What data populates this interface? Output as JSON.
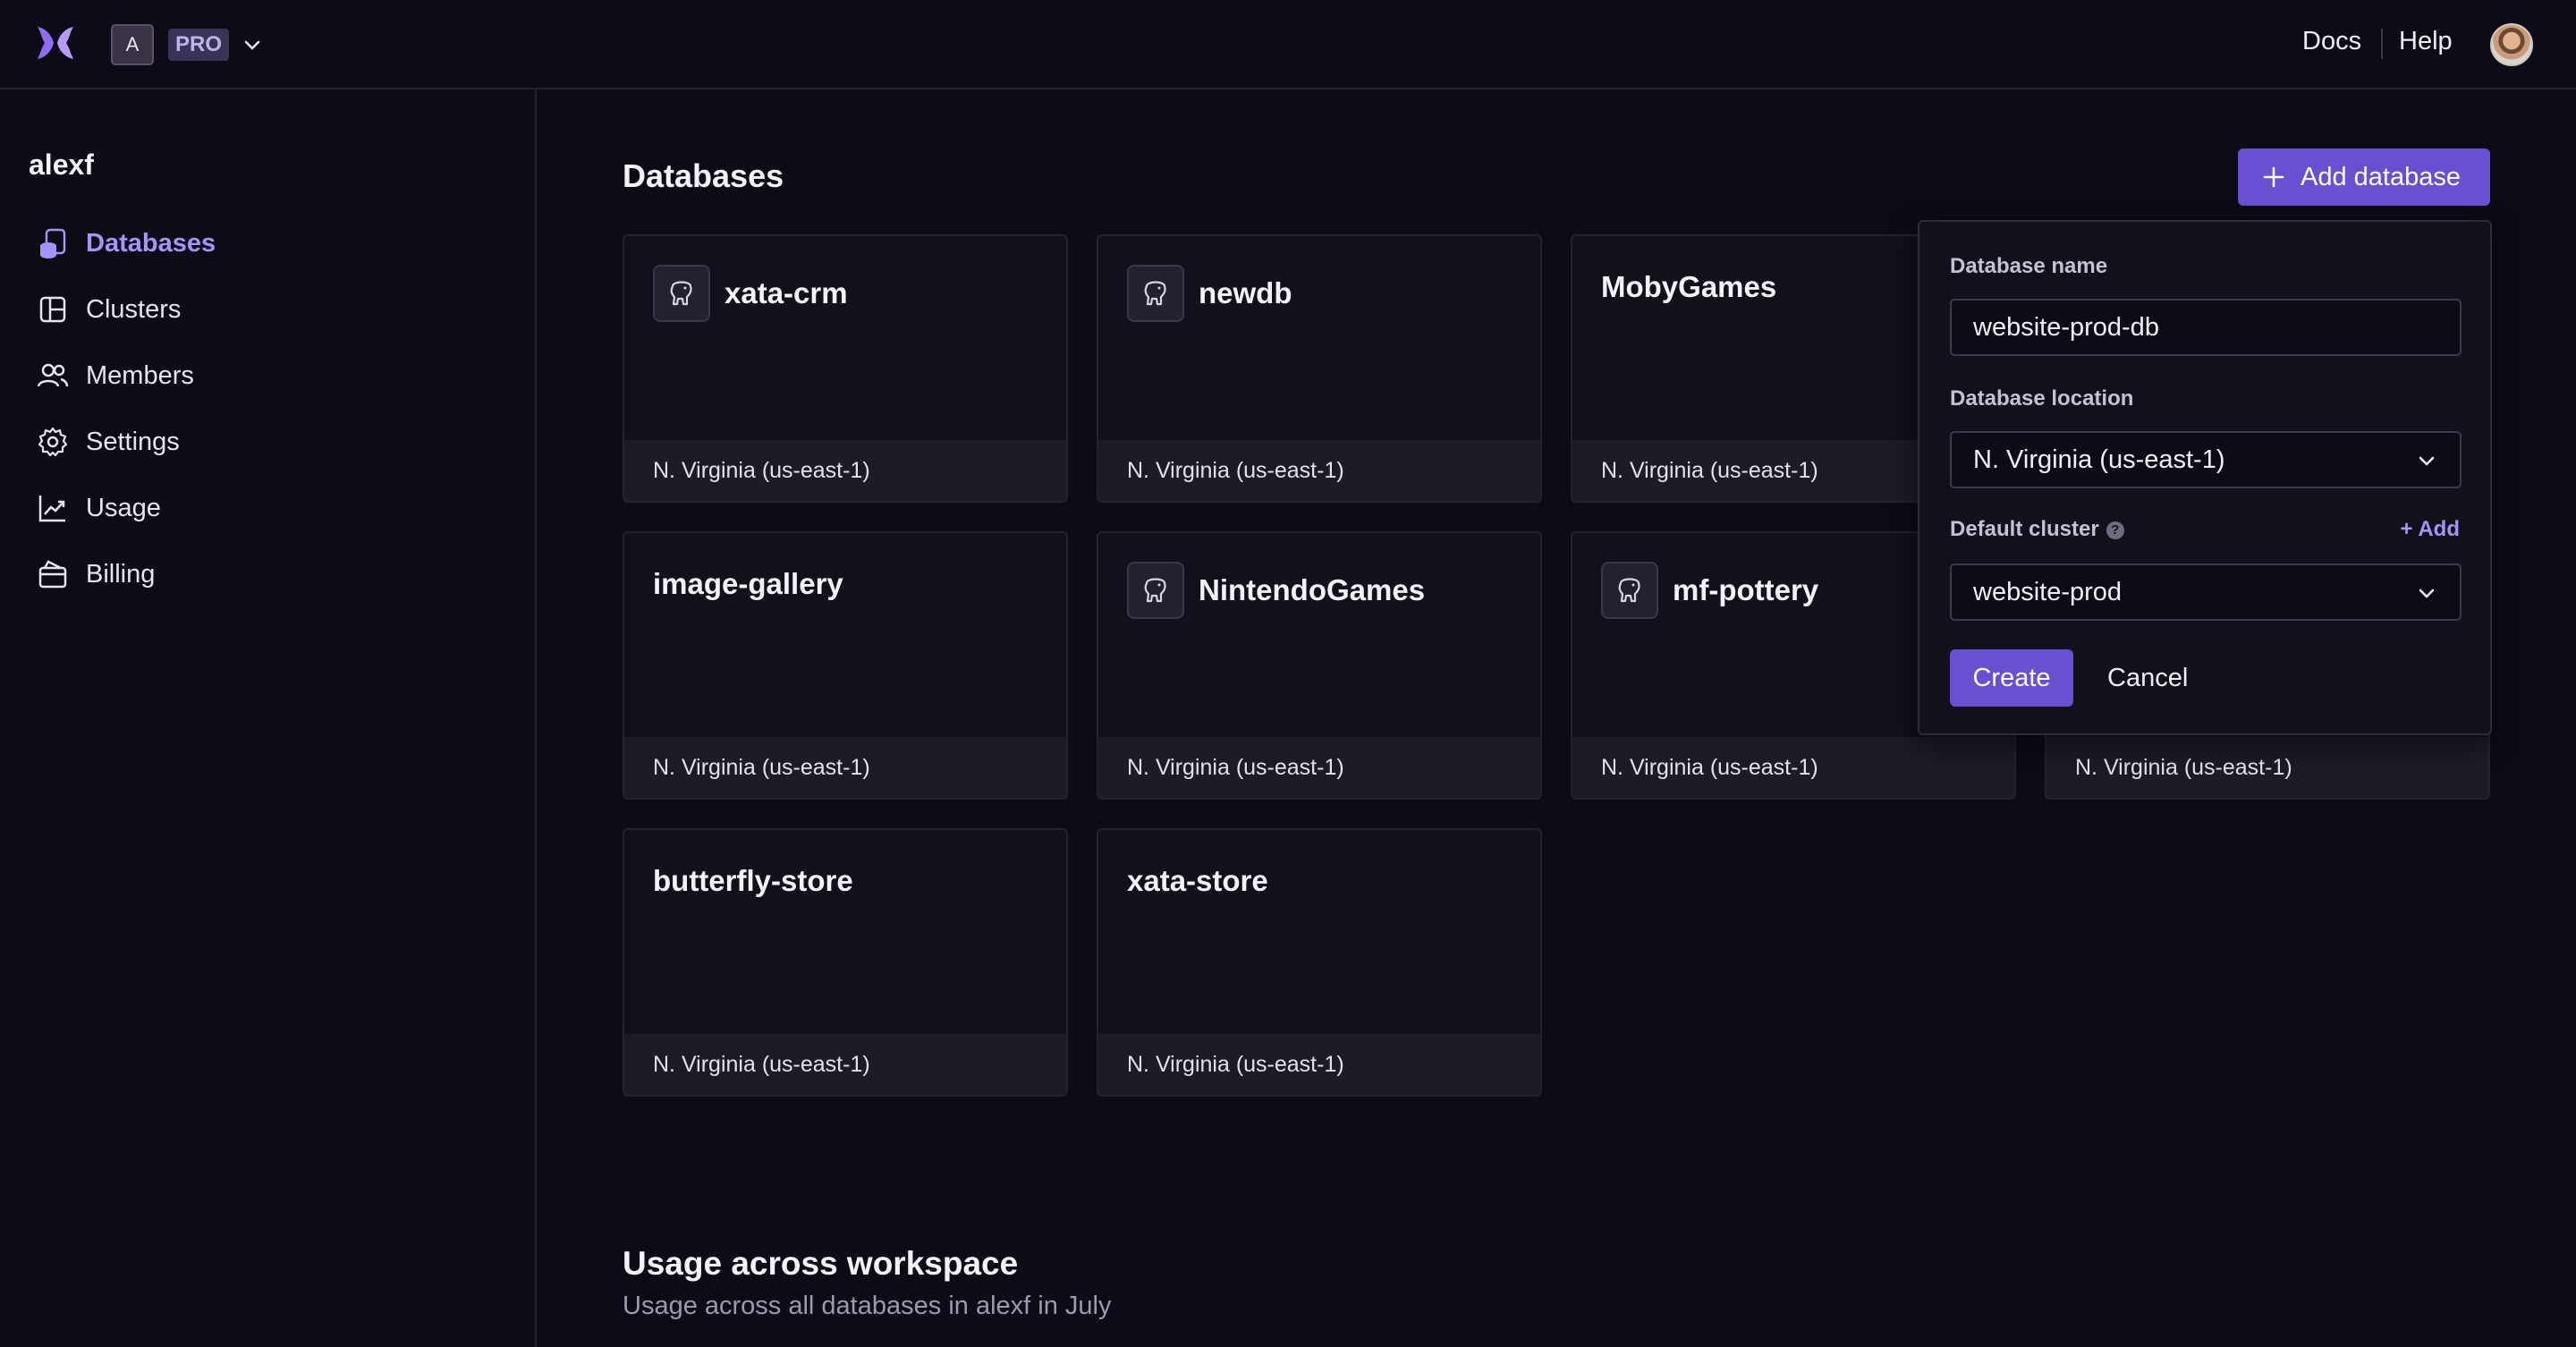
{
  "header": {
    "workspace_initial": "A",
    "plan_badge": "PRO",
    "docs_label": "Docs",
    "help_label": "Help"
  },
  "sidebar": {
    "workspace_name": "alexf",
    "items": [
      {
        "label": "Databases",
        "icon": "database-icon",
        "active": true
      },
      {
        "label": "Clusters",
        "icon": "clusters-icon",
        "active": false
      },
      {
        "label": "Members",
        "icon": "members-icon",
        "active": false
      },
      {
        "label": "Settings",
        "icon": "gear-icon",
        "active": false
      },
      {
        "label": "Usage",
        "icon": "chart-icon",
        "active": false
      },
      {
        "label": "Billing",
        "icon": "billing-icon",
        "active": false
      }
    ]
  },
  "main": {
    "title": "Databases",
    "add_button_label": "Add database",
    "databases": [
      {
        "name": "xata-crm",
        "region": "N. Virginia (us-east-1)",
        "postgres_icon": true
      },
      {
        "name": "newdb",
        "region": "N. Virginia (us-east-1)",
        "postgres_icon": true
      },
      {
        "name": "MobyGames",
        "region": "N. Virginia (us-east-1)",
        "postgres_icon": false
      },
      {
        "name": "image-gallery",
        "region": "N. Virginia (us-east-1)",
        "postgres_icon": false
      },
      {
        "name": "NintendoGames",
        "region": "N. Virginia (us-east-1)",
        "postgres_icon": true
      },
      {
        "name": "mf-pottery",
        "region": "N. Virginia (us-east-1)",
        "postgres_icon": true
      },
      {
        "name": "",
        "region": "N. Virginia (us-east-1)",
        "postgres_icon": false
      },
      {
        "name": "butterfly-store",
        "region": "N. Virginia (us-east-1)",
        "postgres_icon": false
      },
      {
        "name": "xata-store",
        "region": "N. Virginia (us-east-1)",
        "postgres_icon": false
      }
    ],
    "usage_title": "Usage across workspace",
    "usage_subtitle": "Usage across all databases in alexf in July"
  },
  "popover": {
    "name_label": "Database name",
    "name_value": "website-prod-db",
    "location_label": "Database location",
    "location_value": "N. Virginia (us-east-1)",
    "cluster_label": "Default cluster",
    "cluster_add_label": "+ Add",
    "cluster_value": "website-prod",
    "help_glyph": "?",
    "create_label": "Create",
    "cancel_label": "Cancel"
  },
  "colors": {
    "accent": "#6a4fd1",
    "accent_text": "#a594f9",
    "background": "#0c0b16",
    "card_footer": "#1c1b26"
  }
}
